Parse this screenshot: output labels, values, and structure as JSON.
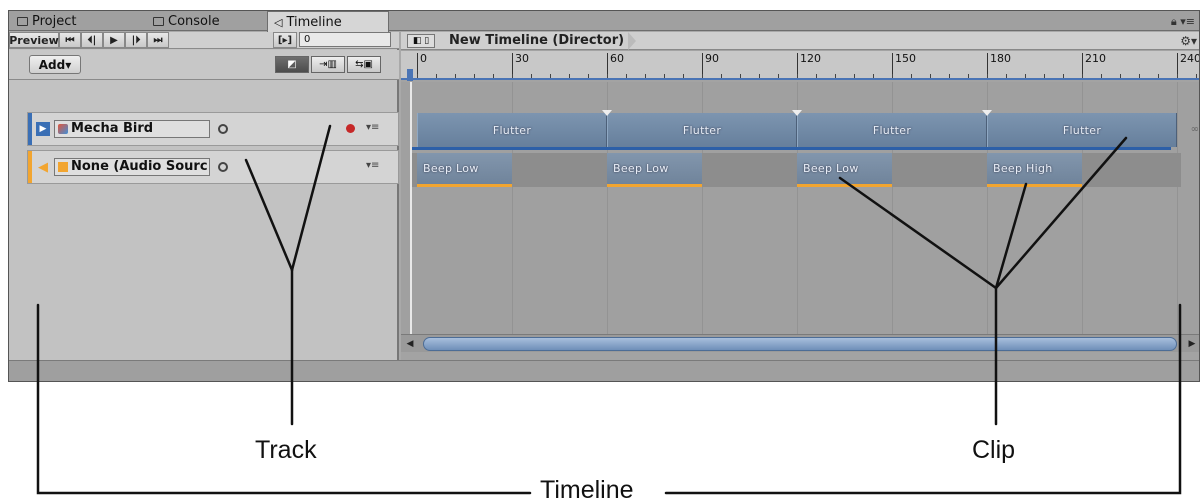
{
  "tabs": [
    {
      "label": "Project",
      "icon": "folder-icon"
    },
    {
      "label": "Console",
      "icon": "console-icon"
    },
    {
      "label": "Timeline",
      "icon": "timeline-icon",
      "active": true
    }
  ],
  "transport": {
    "preview_label": "Preview",
    "controls": [
      "⏮",
      "⏴|",
      "▶",
      "|⏵",
      "⏭"
    ],
    "frame_toggle": "[▸]",
    "current_frame": "0"
  },
  "toolbar": {
    "add_label": "Add▾",
    "mode_buttons": [
      "edit-mode-icon",
      "ripple-mode-icon",
      "replace-mode-icon"
    ]
  },
  "tracks": [
    {
      "name": "Mecha Bird",
      "type": "animation",
      "color": "#3a6fb5"
    },
    {
      "name": "None (Audio Sourc",
      "type": "audio",
      "color": "#f2a530"
    }
  ],
  "timeline": {
    "title": "New Timeline (Director)",
    "ticks": [
      "0",
      "30",
      "60",
      "90",
      "120",
      "150",
      "180",
      "210",
      "240"
    ]
  },
  "clips": {
    "animation": [
      "Flutter",
      "Flutter",
      "Flutter",
      "Flutter"
    ],
    "audio": [
      "Beep Low",
      "Beep Low",
      "Beep Low",
      "Beep High"
    ]
  },
  "annotations": {
    "track": "Track",
    "clip": "Clip",
    "timeline": "Timeline"
  }
}
